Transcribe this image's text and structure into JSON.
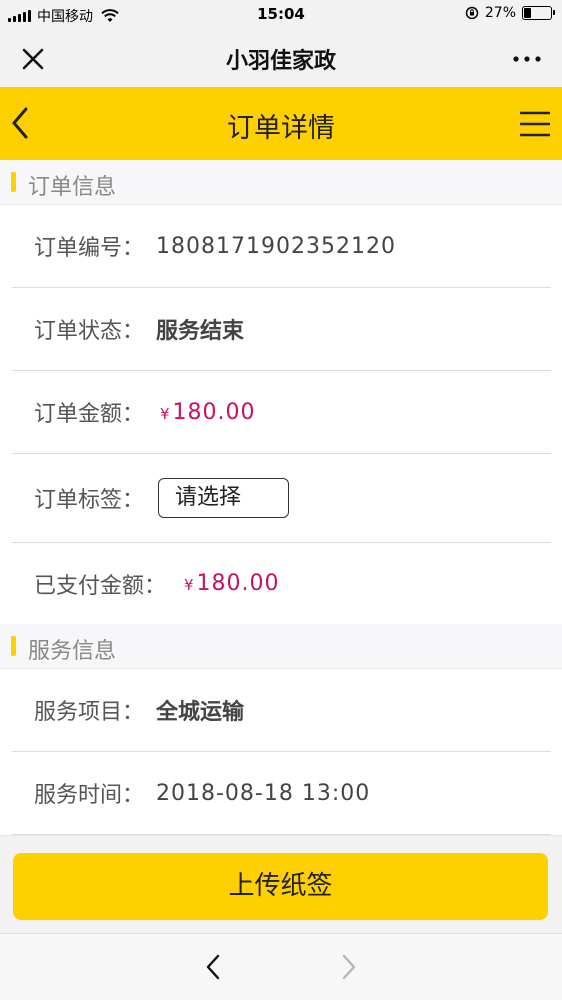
{
  "status_bar": {
    "carrier": "中国移动",
    "time": "15:04",
    "battery": "27%",
    "battery_level": 0.27
  },
  "wechat_bar": {
    "title": "小羽佳家政",
    "close_icon": "close-icon",
    "more_icon": "more-icon"
  },
  "header": {
    "title": "订单详情",
    "back_icon": "chevron-left-icon",
    "menu_icon": "hamburger-menu-icon"
  },
  "order_info": {
    "section_title": "订单信息",
    "order_no_label": "订单编号：",
    "order_no": "1808171902352120",
    "status_label": "订单状态：",
    "status": "服务结束",
    "amount_label": "订单金额：",
    "amount_currency": "¥",
    "amount": "180.00",
    "tag_label": "订单标签：",
    "tag_placeholder": "请选择",
    "paid_label": "已支付金额：",
    "paid_currency": "¥",
    "paid": "180.00"
  },
  "service_info": {
    "section_title": "服务信息",
    "item_label": "服务项目：",
    "item": "全城运输",
    "time_label": "服务时间：",
    "time": "2018-08-18 13:00"
  },
  "actions": {
    "upload_label": "上传纸签"
  },
  "colors": {
    "accent": "#ffd000",
    "price": "#c8106a"
  }
}
